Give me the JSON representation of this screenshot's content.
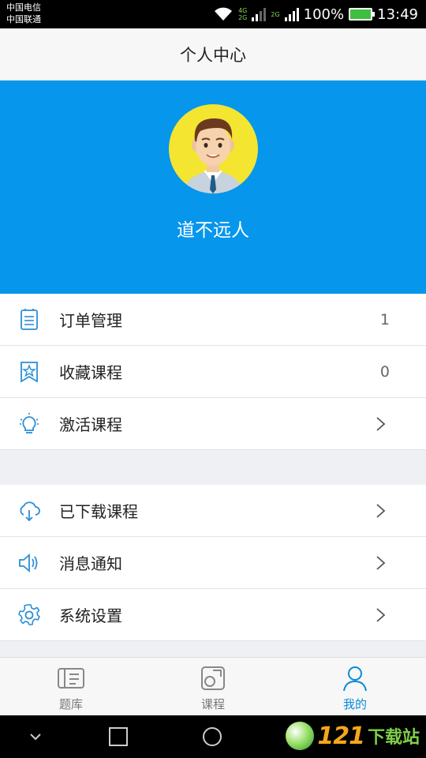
{
  "status_bar": {
    "carrier1": "中国电信",
    "carrier2": "中国联通",
    "net1_top": "4G",
    "net1_bottom": "2G",
    "net2": "2G",
    "battery": "100%",
    "time": "13:49"
  },
  "header": {
    "title": "个人中心"
  },
  "profile": {
    "username": "道不远人",
    "avatar_bg": "#f4e531",
    "header_bg": "#0696ec"
  },
  "menu": {
    "group1": [
      {
        "label": "订单管理",
        "icon": "order-list-icon",
        "count": "1"
      },
      {
        "label": "收藏课程",
        "icon": "star-bookmark-icon",
        "count": "0"
      },
      {
        "label": "激活课程",
        "icon": "lightbulb-icon"
      }
    ],
    "group2": [
      {
        "label": "已下载课程",
        "icon": "cloud-download-icon"
      },
      {
        "label": "消息通知",
        "icon": "speaker-icon"
      },
      {
        "label": "系统设置",
        "icon": "gear-icon"
      }
    ]
  },
  "tabs": [
    {
      "label": "题库",
      "icon": "question-bank-icon",
      "active": false
    },
    {
      "label": "课程",
      "icon": "course-icon",
      "active": false
    },
    {
      "label": "我的",
      "icon": "user-icon",
      "active": true
    }
  ],
  "watermark": {
    "digits": "121",
    "text": "下载站"
  },
  "colors": {
    "accent": "#0a8bd8",
    "icon_blue": "#2a8fd6"
  }
}
